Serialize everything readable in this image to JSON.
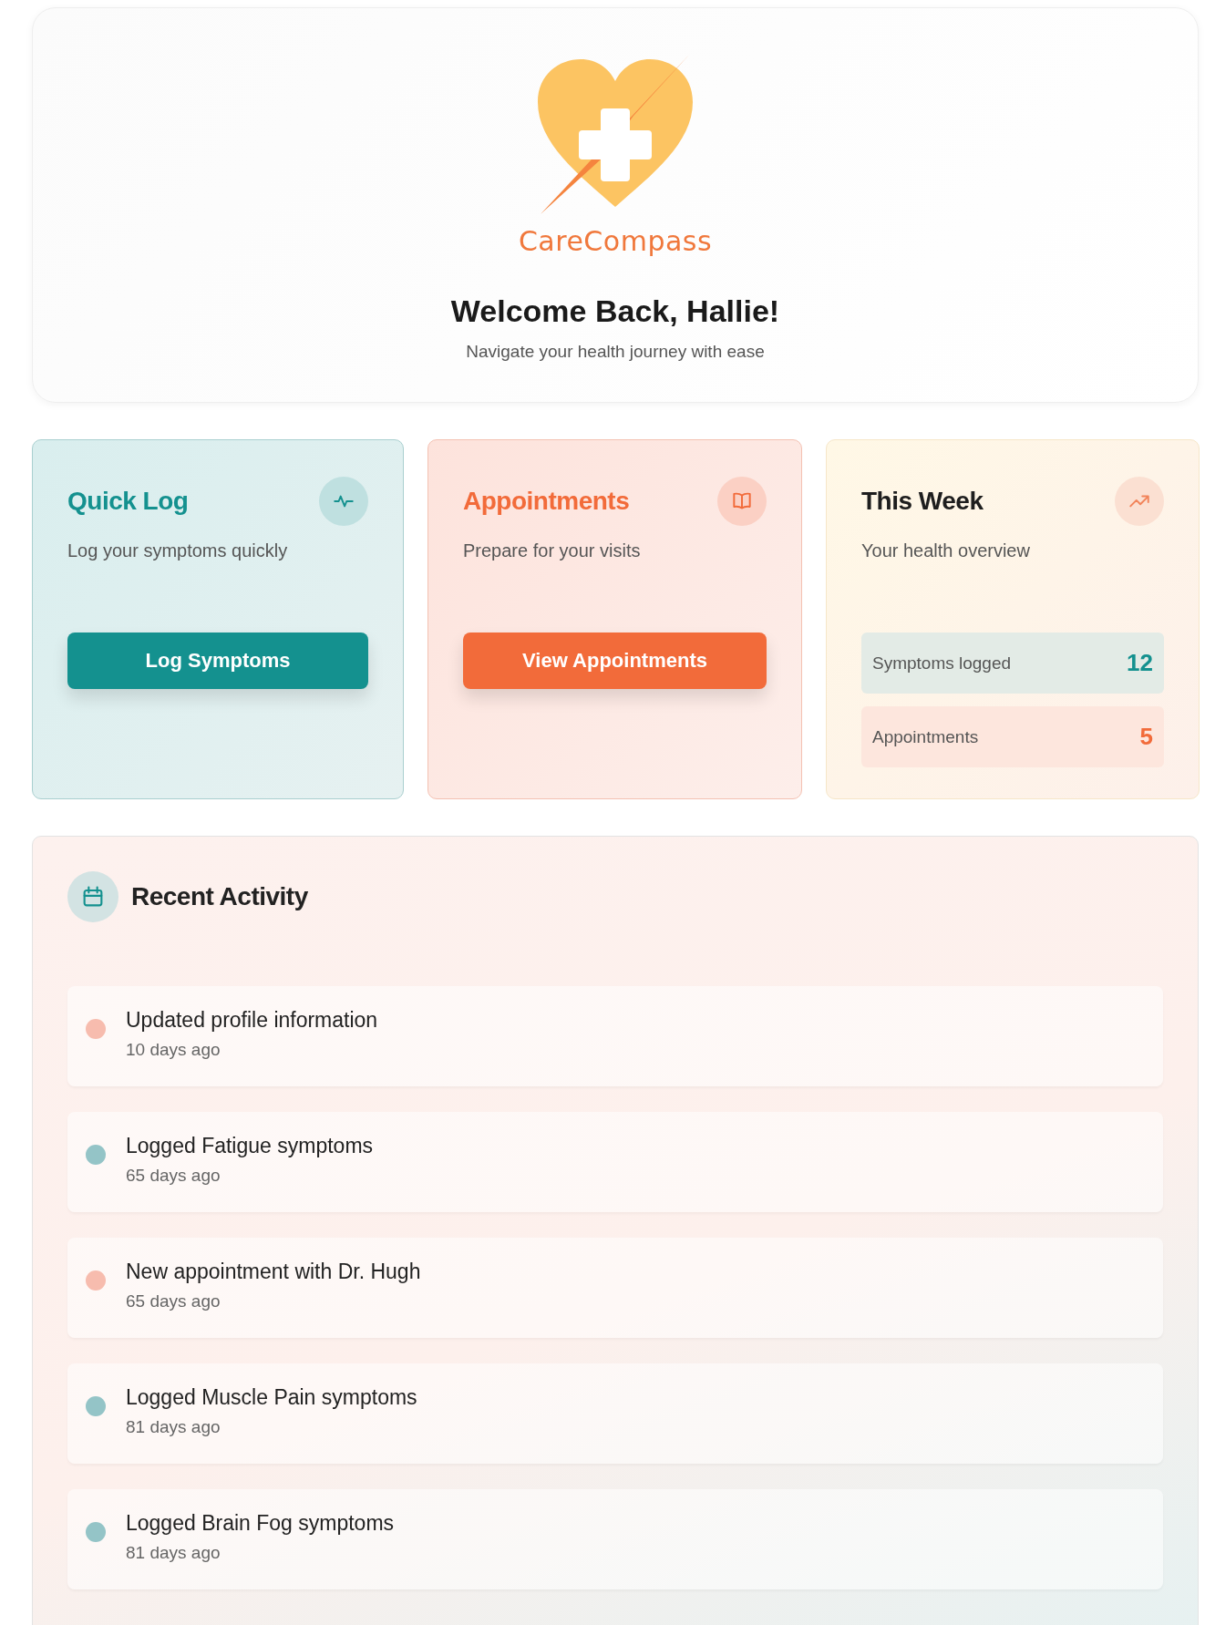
{
  "header": {
    "brand": "CareCompass",
    "title": "Welcome Back, Hallie!",
    "subtitle": "Navigate your health journey with ease"
  },
  "cards": [
    {
      "kind": "action",
      "title": "Quick Log",
      "subtitle": "Log your symptoms quickly",
      "button": "Log Symptoms"
    },
    {
      "kind": "action",
      "title": "Appointments",
      "subtitle": "Prepare for your visits",
      "button": "View Appointments"
    },
    {
      "kind": "stats",
      "title": "This Week",
      "subtitle": "Your health overview",
      "stats": [
        {
          "label": "Symptoms logged",
          "value": "12"
        },
        {
          "label": "Appointments",
          "value": "5"
        }
      ]
    }
  ],
  "activity": {
    "title": "Recent Activity",
    "items": [
      {
        "text": "Updated profile information",
        "time": "10 days ago",
        "color": "#f7bcae"
      },
      {
        "text": "Logged Fatigue symptoms",
        "time": "65 days ago",
        "color": "#94c4c7"
      },
      {
        "text": "New appointment with Dr. Hugh",
        "time": "65 days ago",
        "color": "#f7bcae"
      },
      {
        "text": "Logged Muscle Pain symptoms",
        "time": "81 days ago",
        "color": "#94c4c7"
      },
      {
        "text": "Logged Brain Fog symptoms",
        "time": "81 days ago",
        "color": "#94c4c7"
      }
    ]
  }
}
